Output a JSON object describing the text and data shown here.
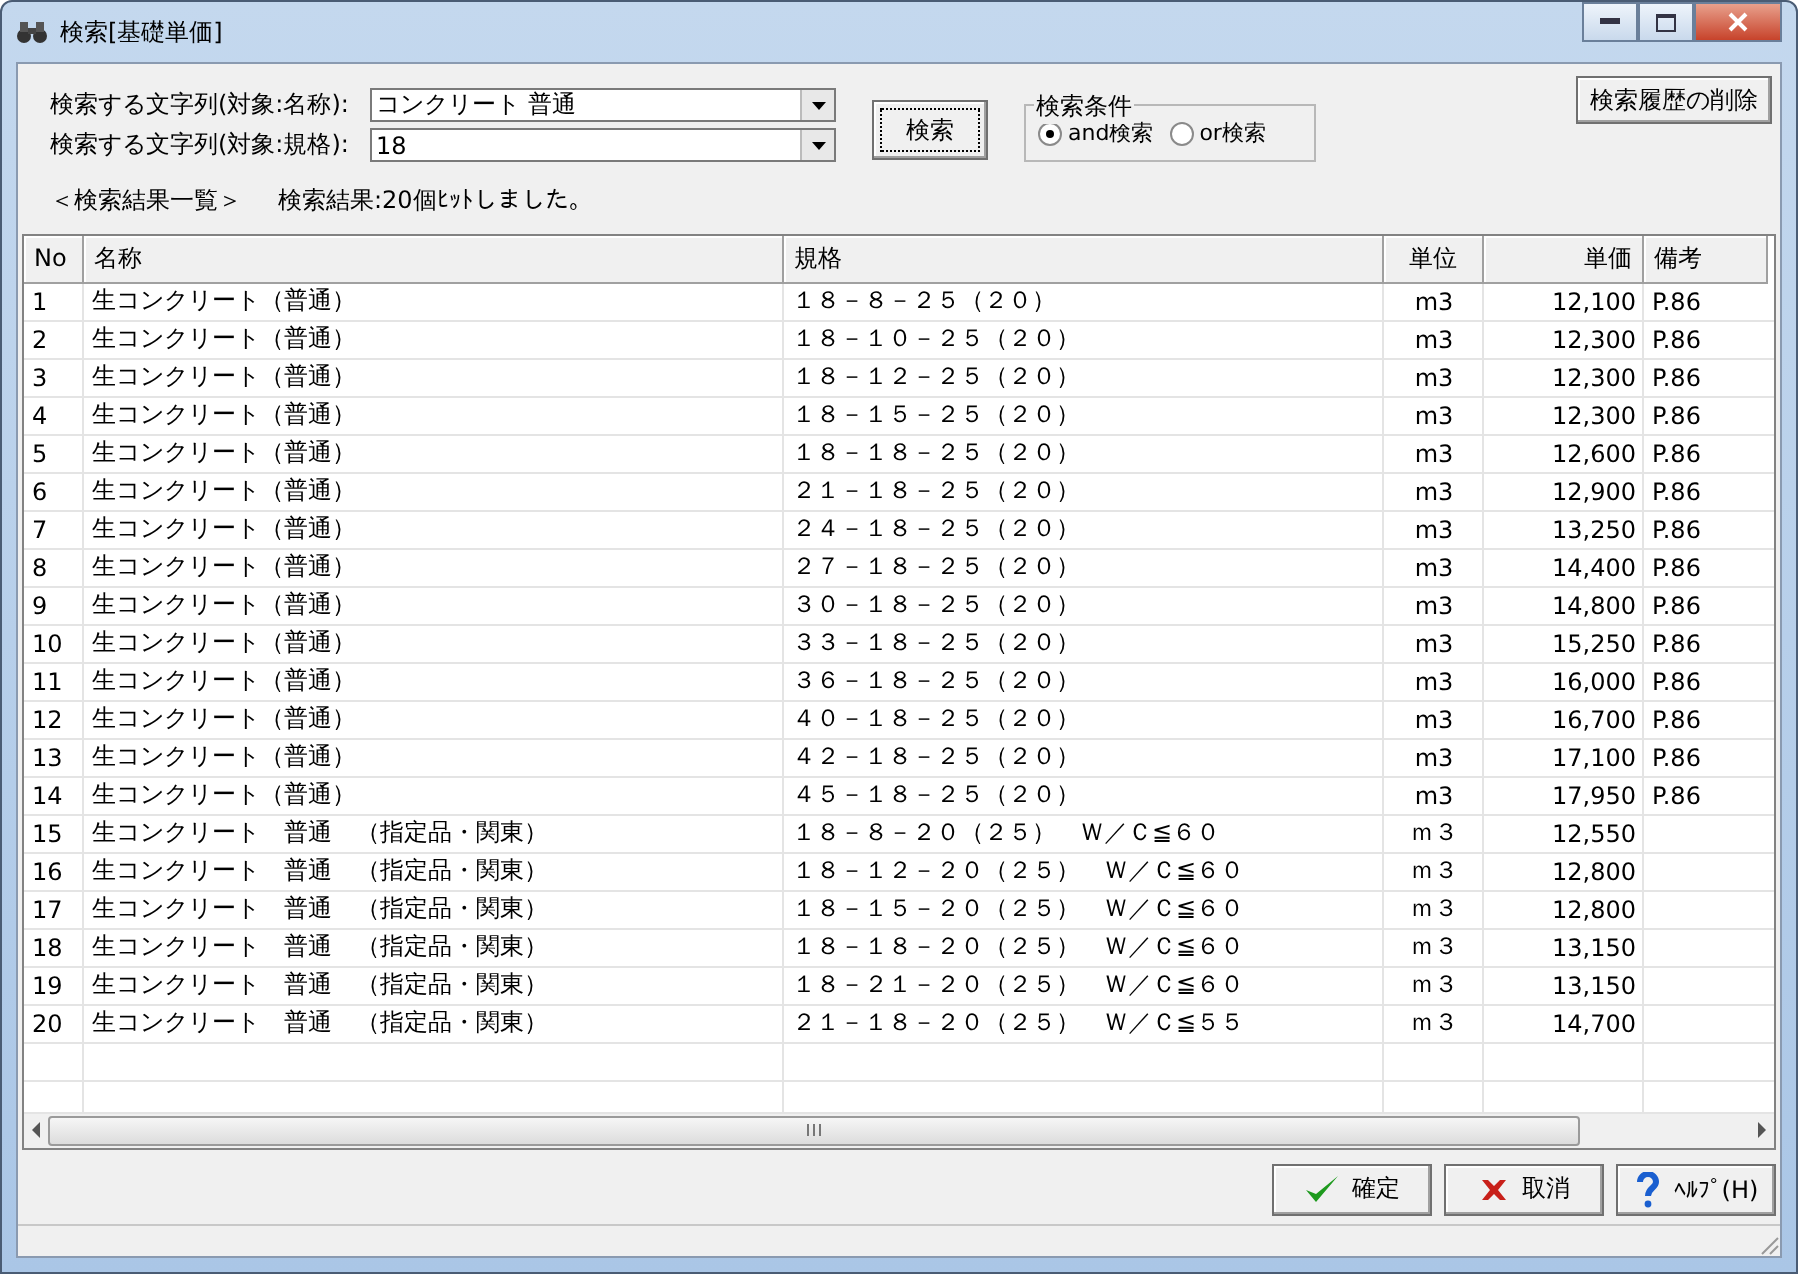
{
  "window": {
    "title": "検索[基礎単価]"
  },
  "search_fields": [
    {
      "label": "検索する文字列(対象:名称):",
      "value": "コンクリート 普通"
    },
    {
      "label": "検索する文字列(対象:規格):",
      "value": "18"
    }
  ],
  "search_button": "検索",
  "search_condition": {
    "title": "検索条件",
    "options": [
      {
        "label": "and検索",
        "selected": true
      },
      {
        "label": "or検索",
        "selected": false
      }
    ]
  },
  "clear_history_button": "検索履歴の削除",
  "result_heading": "＜検索結果一覧＞",
  "result_count": "検索結果:20個ﾋｯﾄしました。",
  "table": {
    "columns": [
      "No",
      "名称",
      "規格",
      "単位",
      "単価",
      "備考"
    ],
    "rows": [
      [
        "1",
        "生コンクリート（普通）",
        "１８－８－２５（２０）",
        "m3",
        "12,100",
        "P.86"
      ],
      [
        "2",
        "生コンクリート（普通）",
        "１８－１０－２５（２０）",
        "m3",
        "12,300",
        "P.86"
      ],
      [
        "3",
        "生コンクリート（普通）",
        "１８－１２－２５（２０）",
        "m3",
        "12,300",
        "P.86"
      ],
      [
        "4",
        "生コンクリート（普通）",
        "１８－１５－２５（２０）",
        "m3",
        "12,300",
        "P.86"
      ],
      [
        "5",
        "生コンクリート（普通）",
        "１８－１８－２５（２０）",
        "m3",
        "12,600",
        "P.86"
      ],
      [
        "6",
        "生コンクリート（普通）",
        "２１－１８－２５（２０）",
        "m3",
        "12,900",
        "P.86"
      ],
      [
        "7",
        "生コンクリート（普通）",
        "２４－１８－２５（２０）",
        "m3",
        "13,250",
        "P.86"
      ],
      [
        "8",
        "生コンクリート（普通）",
        "２７－１８－２５（２０）",
        "m3",
        "14,400",
        "P.86"
      ],
      [
        "9",
        "生コンクリート（普通）",
        "３０－１８－２５（２０）",
        "m3",
        "14,800",
        "P.86"
      ],
      [
        "10",
        "生コンクリート（普通）",
        "３３－１８－２５（２０）",
        "m3",
        "15,250",
        "P.86"
      ],
      [
        "11",
        "生コンクリート（普通）",
        "３６－１８－２５（２０）",
        "m3",
        "16,000",
        "P.86"
      ],
      [
        "12",
        "生コンクリート（普通）",
        "４０－１８－２５（２０）",
        "m3",
        "16,700",
        "P.86"
      ],
      [
        "13",
        "生コンクリート（普通）",
        "４２－１８－２５（２０）",
        "m3",
        "17,100",
        "P.86"
      ],
      [
        "14",
        "生コンクリート（普通）",
        "４５－１８－２５（２０）",
        "m3",
        "17,950",
        "P.86"
      ],
      [
        "15",
        "生コンクリート　普通　（指定品・関東）",
        "１８－８－２０（２５）　Ｗ／Ｃ≦６０",
        "ｍ３",
        "12,550"
      ],
      [
        "16",
        "生コンクリート　普通　（指定品・関東）",
        "１８－１２－２０（２５）　Ｗ／Ｃ≦６０",
        "ｍ３",
        "12,800"
      ],
      [
        "17",
        "生コンクリート　普通　（指定品・関東）",
        "１８－１５－２０（２５）　Ｗ／Ｃ≦６０",
        "ｍ３",
        "12,800"
      ],
      [
        "18",
        "生コンクリート　普通　（指定品・関東）",
        "１８－１８－２０（２５）　Ｗ／Ｃ≦６０",
        "ｍ３",
        "13,150"
      ],
      [
        "19",
        "生コンクリート　普通　（指定品・関東）",
        "１８－２１－２０（２５）　Ｗ／Ｃ≦６０",
        "ｍ３",
        "13,150"
      ],
      [
        "20",
        "生コンクリート　普通　（指定品・関東）",
        "２１－１８－２０（２５）　Ｗ／Ｃ≦５５",
        "ｍ３",
        "14,700"
      ]
    ]
  },
  "footer_buttons": [
    {
      "kind": "ok",
      "label": "確定"
    },
    {
      "kind": "cancel",
      "label": "取消"
    },
    {
      "kind": "help",
      "label": "ﾍﾙﾌﾟ(H)"
    }
  ]
}
